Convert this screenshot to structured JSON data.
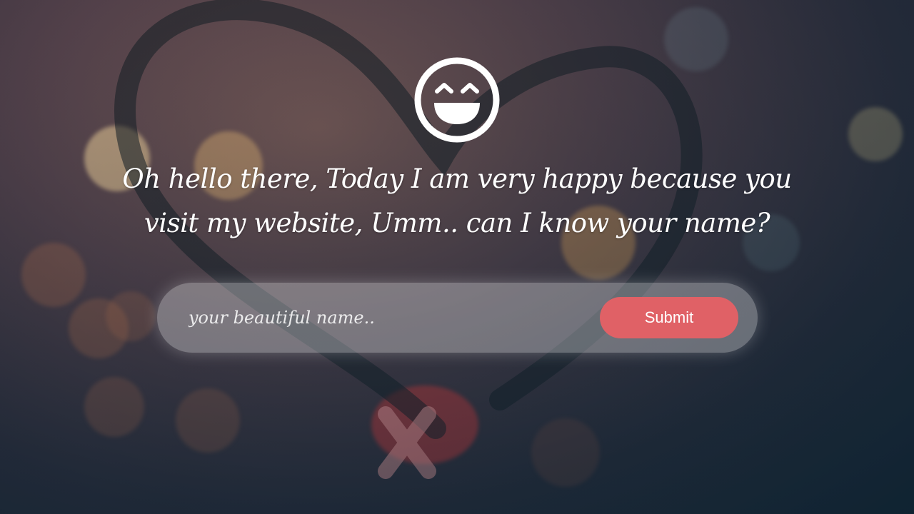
{
  "hero": {
    "icon": "smiley-face-icon",
    "greeting": "Oh hello there, Today I am very happy because you visit my website, Umm.. can I know your name?"
  },
  "form": {
    "name_placeholder": "your beautiful name..",
    "name_value": "",
    "submit_label": "Submit"
  },
  "colors": {
    "accent": "#e06166",
    "text": "#ffffff"
  }
}
